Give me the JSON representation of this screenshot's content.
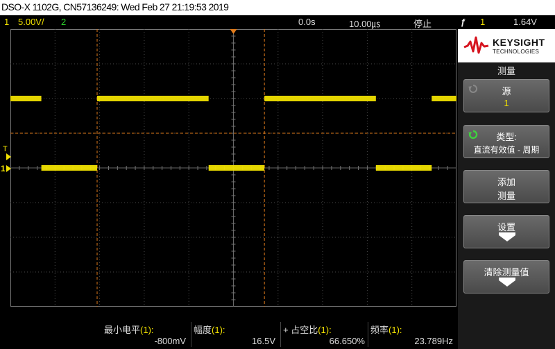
{
  "title": "DSO-X 1102G, CN57136249: Wed Feb 27 21:19:53 2019",
  "status": {
    "ch1_num": "1",
    "ch1_scale": "5.00V/",
    "ch2_num": "2",
    "time_offset": "0.0s",
    "time_scale": "10.00\u0002/",
    "time_scale_display": "10.00㎲",
    "run_state": "停止",
    "trigger_icon": "ƒ",
    "trigger_source": "1",
    "trigger_level": "1.64V"
  },
  "markers": {
    "trigger_label": "T",
    "ch1_ground_label": "1"
  },
  "waveform": {
    "high_level_div": 2,
    "low_level_div": 0,
    "period_us": 37.5,
    "duty_percent": 66.65,
    "timebase_us_per_div": 10,
    "color": "#f0e000"
  },
  "panel": {
    "brand": "KEYSIGHT",
    "brand_sub": "TECHNOLOGIES",
    "menu_title": "测量",
    "source_label": "源",
    "source_value": "1",
    "type_label": "类型:",
    "type_value": "直流有效值 - 周期",
    "add_label_1": "添加",
    "add_label_2": "测量",
    "settings_label": "设置",
    "clear_label": "清除测量值"
  },
  "measurements": [
    {
      "name": "最小电平",
      "channel": "(1):",
      "value": "-800mV"
    },
    {
      "name": "幅度",
      "channel": "(1):",
      "value": "16.5V"
    },
    {
      "name": "+ 占空比",
      "channel": "(1):",
      "value": "66.650%"
    },
    {
      "name": "频率",
      "channel": "(1):",
      "value": "23.789Hz"
    }
  ],
  "colors": {
    "ch1": "#f0e000",
    "ch2": "#2bd12b",
    "cursor": "#e07a1a",
    "grid": "#4a4a4a"
  }
}
